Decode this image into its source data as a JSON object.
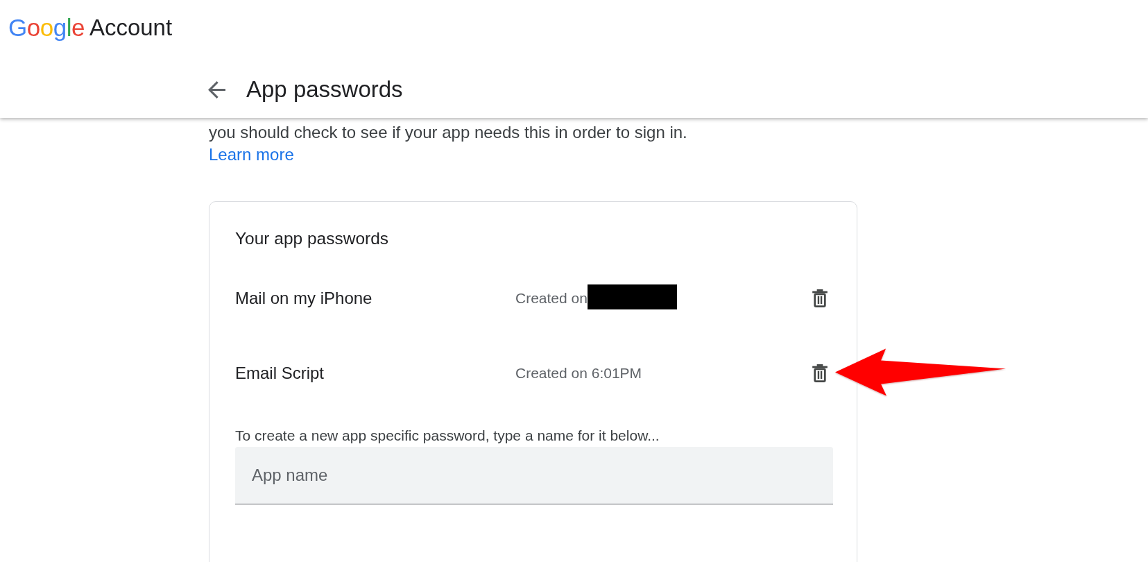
{
  "header": {
    "logo": {
      "wordmark": "Google",
      "product": "Account"
    },
    "title": "App passwords"
  },
  "intro": {
    "text": "you should check to see if your app needs this in order to sign in.",
    "link": "Learn more"
  },
  "card": {
    "title": "Your app passwords",
    "passwords": [
      {
        "name": "Mail on my iPhone",
        "created": "Created on",
        "redacted": true,
        "arrow_callout": false
      },
      {
        "name": "Email Script",
        "created": "Created on 6:01PM",
        "redacted": false,
        "arrow_callout": true
      }
    ],
    "new_password": {
      "hint": "To create a new app specific password, type a name for it below...",
      "placeholder": "App name"
    }
  }
}
